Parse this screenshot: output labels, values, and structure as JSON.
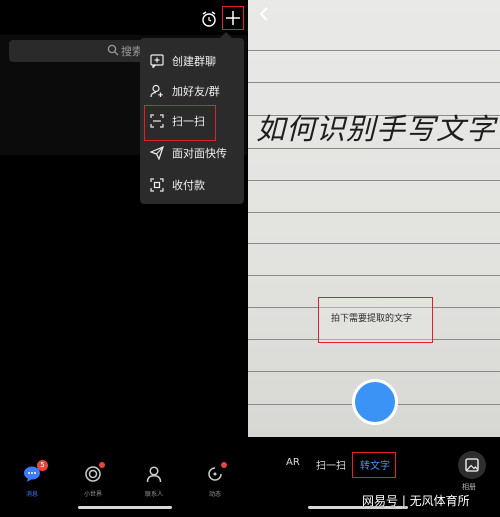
{
  "left_screen": {
    "search": {
      "placeholder": "搜索"
    },
    "menu": {
      "items": [
        {
          "label": "创建群聊",
          "icon": "group-chat-icon"
        },
        {
          "label": "加好友/群",
          "icon": "add-friend-icon"
        },
        {
          "label": "扫一扫",
          "icon": "scan-icon"
        },
        {
          "label": "面对面快传",
          "icon": "send-icon"
        },
        {
          "label": "收付款",
          "icon": "payment-icon"
        }
      ]
    },
    "nav": {
      "items": [
        {
          "label": "消息",
          "icon": "message-icon",
          "badge": "5"
        },
        {
          "label": "小世界",
          "icon": "world-icon"
        },
        {
          "label": "联系人",
          "icon": "contacts-icon"
        },
        {
          "label": "动态",
          "icon": "activity-icon"
        }
      ]
    },
    "colors": {
      "highlight": "#e0202a",
      "accent": "#3b7bff",
      "badge": "#e8453c"
    }
  },
  "right_screen": {
    "handwritten_text": "如何识别手写文字",
    "tip": "拍下需要提取的文字",
    "modes": [
      "AR",
      "扫一扫",
      "转文字"
    ],
    "active_mode": "转文字",
    "album_label": "相册",
    "colors": {
      "shutter": "#3a93f5",
      "active_mode": "#4a90ff"
    }
  },
  "watermark": "网易号 | 无风体育所"
}
